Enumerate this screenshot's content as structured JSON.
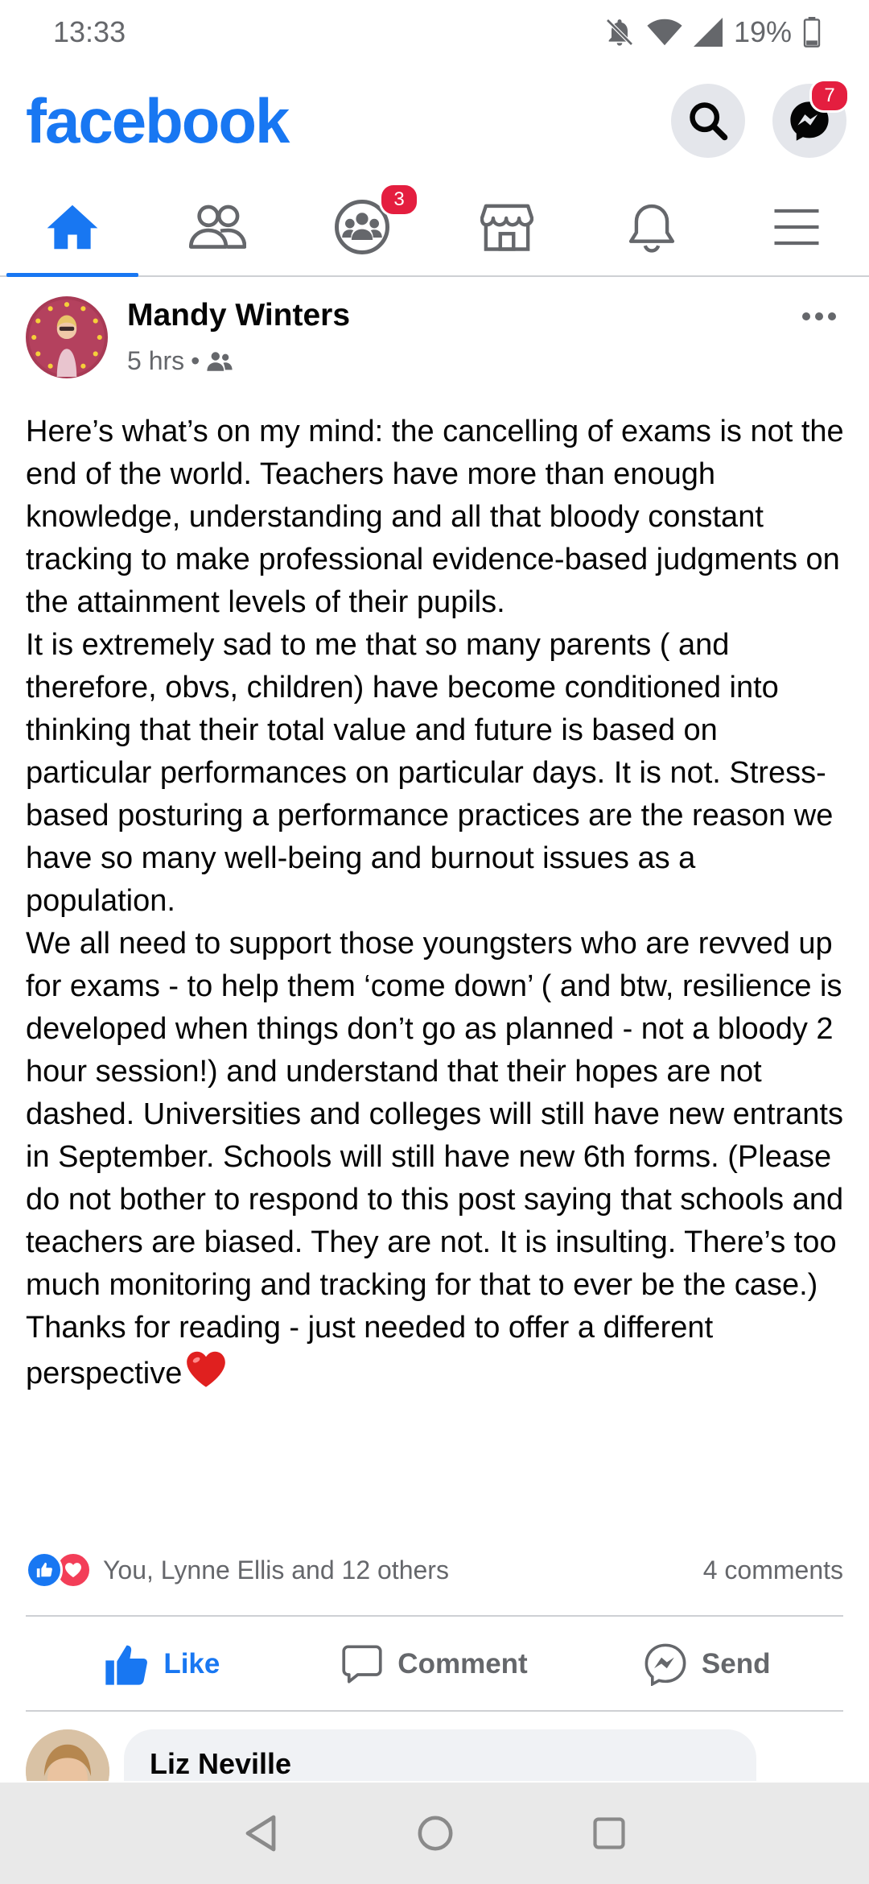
{
  "status_bar": {
    "time": "13:33",
    "battery": "19%",
    "icons": [
      "bell-off-icon",
      "wifi-icon",
      "signal-icon",
      "battery-icon"
    ]
  },
  "header": {
    "logo": "facebook",
    "search_icon": "search-icon",
    "messenger_icon": "messenger-icon",
    "messenger_badge": "7",
    "brand_color": "#1877f2"
  },
  "nav_tabs": [
    {
      "name": "home",
      "icon": "home-icon",
      "active": true,
      "badge": ""
    },
    {
      "name": "friends",
      "icon": "friends-icon",
      "active": false,
      "badge": ""
    },
    {
      "name": "groups",
      "icon": "groups-icon",
      "active": false,
      "badge": "3"
    },
    {
      "name": "marketplace",
      "icon": "marketplace-icon",
      "active": false,
      "badge": ""
    },
    {
      "name": "notifications",
      "icon": "bell-icon",
      "active": false,
      "badge": ""
    },
    {
      "name": "menu",
      "icon": "menu-icon",
      "active": false,
      "badge": ""
    }
  ],
  "post": {
    "author": "Mandy Winters",
    "time": "5 hrs",
    "separator": "•",
    "audience_icon": "friends-icon",
    "body": "Here’s what’s on my mind: the cancelling of exams is not the end of the world. Teachers have more than enough knowledge, understanding and all that  bloody constant tracking to make professional evidence-based judgments on the attainment levels of their pupils.\nIt is extremely sad to me that so many parents ( and therefore, obvs, children) have become conditioned into thinking that their total value and future is based on particular performances on particular days. It is not. Stress-based posturing a performance practices are the reason we have so many well-being and burnout issues as a population.\nWe all need to support those youngsters who are revved up for exams - to help them ‘come down’ ( and btw, resilience is developed when things don’t go as planned - not a bloody 2 hour session!) and understand that their hopes are not dashed. Universities and colleges will still have new entrants in September. Schools will still have new 6th forms. (Please do not bother to respond to this post saying that schools and teachers are biased. They are not. It is insulting. There’s too much monitoring and tracking for that to ever be the case.)\nThanks for reading - just needed to offer a different perspective",
    "reactions_text": "You, Lynne Ellis and 12 others",
    "comments_count": "4 comments",
    "actions": {
      "like": "Like",
      "comment": "Comment",
      "send": "Send"
    }
  },
  "comment_preview": {
    "name": "Liz Neville"
  }
}
